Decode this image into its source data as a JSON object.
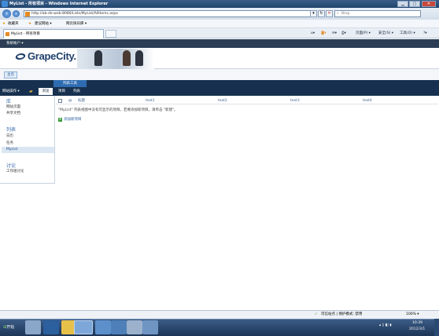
{
  "window": {
    "title": "MyList - 所有项目 - Windows Internet Explorer"
  },
  "address": {
    "url": "http://ab-de-web:8080/Lists/MyList/AllItems.aspx",
    "search_placeholder": "Bing"
  },
  "favorites": {
    "label": "收藏夹",
    "items": [
      "建议网站 ▾",
      "网页快讯库 ▾"
    ]
  },
  "tab": {
    "title": "MyList - 所有项目"
  },
  "commandbar": {
    "items": [
      "页面(P) ▾",
      "安全(S) ▾",
      "工具(O) ▾"
    ]
  },
  "sharepoint": {
    "top_link": "系统帐户 ▾",
    "logo_text": "GrapeCity.",
    "breadcrumb_home": "主页",
    "ribbon": {
      "site_actions": "网站操作 ▾",
      "browse": "浏览",
      "context_group": "列表工具",
      "tabs": [
        "项目",
        "列表"
      ]
    },
    "leftnav": {
      "sections": [
        {
          "heading": "库",
          "items": [
            "网站页面",
            "共享文档"
          ]
        },
        {
          "heading": "列表",
          "items": [
            "日历",
            "任务"
          ]
        },
        {
          "heading": "讨论",
          "items": [
            "工作组讨论"
          ]
        }
      ],
      "selected": "MyList"
    },
    "list": {
      "columns": [
        "标题",
        "text1",
        "text2",
        "text3",
        "text4"
      ],
      "empty_message": "\"MyList\" 列表视图中没有可显示的项目。若要添加新项目，请单击 \"新建\"。",
      "add_item": "添加新项目"
    }
  },
  "status": {
    "zone": "可信站点 | 保护模式: 禁用",
    "zoom": "100% ▾"
  },
  "taskbar": {
    "start": "开始",
    "time": "10:39",
    "date": "2012/3/1"
  }
}
